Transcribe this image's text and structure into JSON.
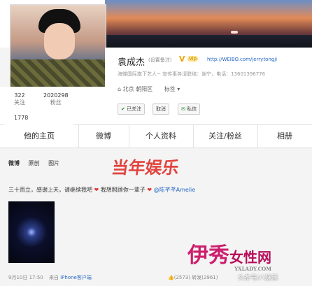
{
  "profile": {
    "name": "袁成杰",
    "remark": "(设置备注)",
    "verified": "V",
    "vip": "Vip",
    "url": "http://WEIBO.com/jerrytongji",
    "description": "海蝶国际旗下艺人~ 宣传事务请联络：谢宁，电话：13601396776",
    "location": "北京 朝阳区",
    "tag": "标签 ▾",
    "buttons": {
      "followed": "已关注",
      "unfollow": "取消",
      "message": "私信"
    }
  },
  "stats": [
    {
      "num": "322",
      "label": "关注"
    },
    {
      "num": "2020298",
      "label": "粉丝"
    },
    {
      "num": "1778",
      "label": ""
    }
  ],
  "tabs": [
    "他的主页",
    "微博",
    "个人资料",
    "关注/粉丝",
    "相册"
  ],
  "feed_filter": [
    "微博",
    "原创",
    "图片"
  ],
  "post": {
    "text1": "三十而立，感谢上天，请继续我吧",
    "heart": "❤",
    "text2": "我想照顾你一辈子",
    "text3": "@陈芊芊Amelie"
  },
  "meta": {
    "time": "9月10日 17:50",
    "from": "来自",
    "source": "iPhone客户端"
  },
  "actions": "👍(2573)    转发(2961)",
  "watermarks": {
    "top": "当年娱乐",
    "brand": "伊秀",
    "brand2": "女性网",
    "site": "YXLADY.COM",
    "corner": "头条号/八脉团"
  },
  "colors": {
    "link": "#2a6ac3",
    "heart": "#e03a3a",
    "verified": "#f0a400"
  }
}
